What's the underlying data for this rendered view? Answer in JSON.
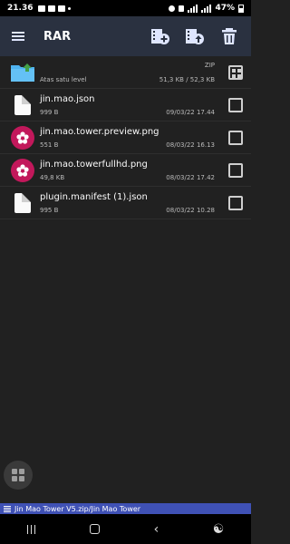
{
  "status": {
    "time": "21.36",
    "battery": "47%"
  },
  "appbar": {
    "title": "RAR"
  },
  "parent": {
    "label": "Atas satu level",
    "type": "ZIP",
    "size": "51,3 KB / 52,3 KB"
  },
  "files": [
    {
      "name": "jin.mao.json",
      "size": "999 B",
      "date": "09/03/22 17.44",
      "icon": "document-icon"
    },
    {
      "name": "jin.mao.tower.preview.png",
      "size": "551 B",
      "date": "08/03/22 16.13",
      "icon": "image-flower-icon"
    },
    {
      "name": "jin.mao.towerfullhd.png",
      "size": "49,8 KB",
      "date": "08/03/22 17.42",
      "icon": "image-flower-icon"
    },
    {
      "name": "plugin.manifest (1).json",
      "size": "995 B",
      "date": "08/03/22 10.28",
      "icon": "document-icon"
    }
  ],
  "pathbar": {
    "path": "Jin Mao Tower V5.zip/Jin Mao Tower"
  },
  "colors": {
    "appbar": "#2a3140",
    "accent": "#3f51b5",
    "image_badge": "#c2185b",
    "folder": "#4fb3f0"
  }
}
